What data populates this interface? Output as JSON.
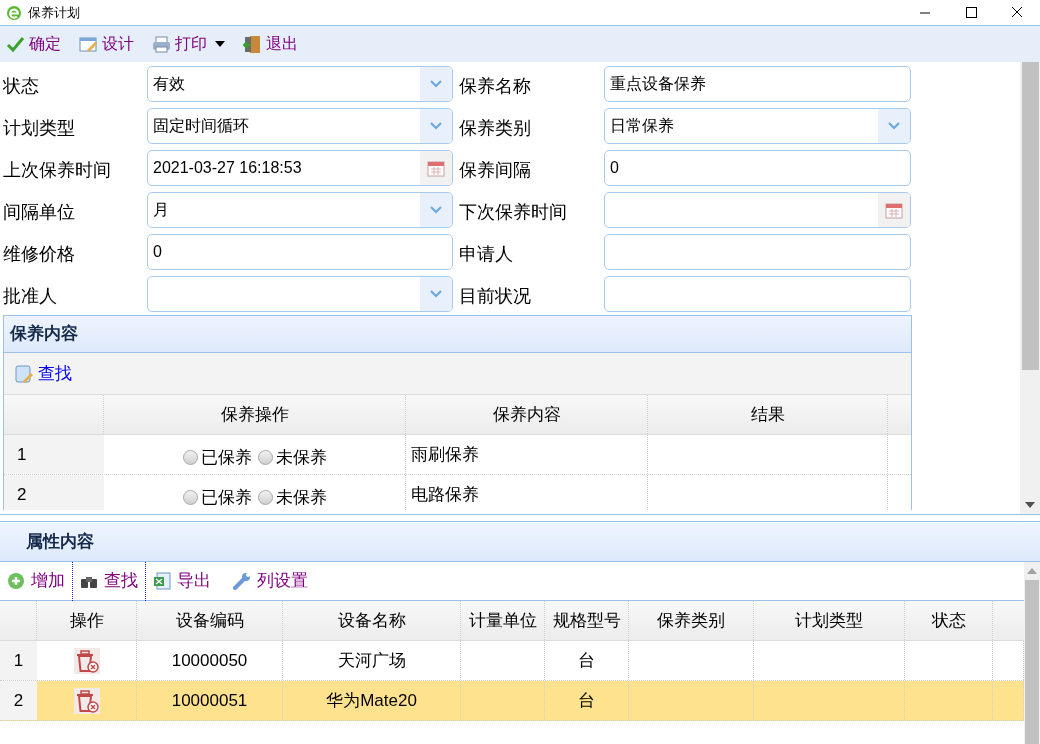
{
  "window": {
    "title": "保养计划"
  },
  "toolbar": [
    {
      "label": "确定",
      "has_menu": false
    },
    {
      "label": "设计",
      "has_menu": false
    },
    {
      "label": "打印",
      "has_menu": true
    },
    {
      "label": "退出",
      "has_menu": false
    }
  ],
  "form": {
    "fields": [
      {
        "label": "状态",
        "kind": "select",
        "value": "有效"
      },
      {
        "label": "保养名称",
        "kind": "text",
        "value": "重点设备保养"
      },
      {
        "label": "计划类型",
        "kind": "select",
        "value": "固定时间循环"
      },
      {
        "label": "保养类别",
        "kind": "select",
        "value": "日常保养"
      },
      {
        "label": "上次保养时间",
        "kind": "date",
        "value": "2021-03-27 16:18:53"
      },
      {
        "label": "保养间隔",
        "kind": "text",
        "value": "0"
      },
      {
        "label": "间隔单位",
        "kind": "select",
        "value": "月"
      },
      {
        "label": "下次保养时间",
        "kind": "date"
      },
      {
        "label": "维修价格",
        "kind": "text",
        "value": "0"
      },
      {
        "label": "申请人",
        "kind": "text"
      },
      {
        "label": "批准人",
        "kind": "select"
      },
      {
        "label": "目前状况",
        "kind": "text"
      }
    ]
  },
  "maintenance_panel": {
    "title": "保养内容",
    "toolbar": [
      {
        "label": "查找"
      }
    ],
    "columns": [
      "保养操作",
      "保养内容",
      "结果"
    ],
    "rows": [
      {
        "number": "1",
        "options": [
          {
            "label": "已保养",
            "selected": false
          },
          {
            "label": "未保养",
            "selected": false
          }
        ],
        "content": "雨刷保养"
      },
      {
        "number": "2",
        "options": [
          {
            "label": "已保养",
            "selected": false
          },
          {
            "label": "未保养",
            "selected": false
          }
        ],
        "content": "电路保养"
      }
    ]
  },
  "attributes_panel": {
    "title": "属性内容",
    "toolbar": [
      {
        "label": "增加"
      },
      {
        "label": "查找"
      },
      {
        "label": "导出"
      },
      {
        "label": "列设置"
      }
    ],
    "columns": [
      "操作",
      "设备编码",
      "设备名称",
      "计量单位",
      "规格型号",
      "保养类别",
      "计划类型",
      "状态"
    ],
    "rows": [
      {
        "number": "1",
        "selected": false,
        "code": "10000050",
        "name": "天河广场",
        "spec": "台"
      },
      {
        "number": "2",
        "selected": true,
        "code": "10000051",
        "name": "华为Mate20",
        "spec": "台"
      }
    ]
  }
}
